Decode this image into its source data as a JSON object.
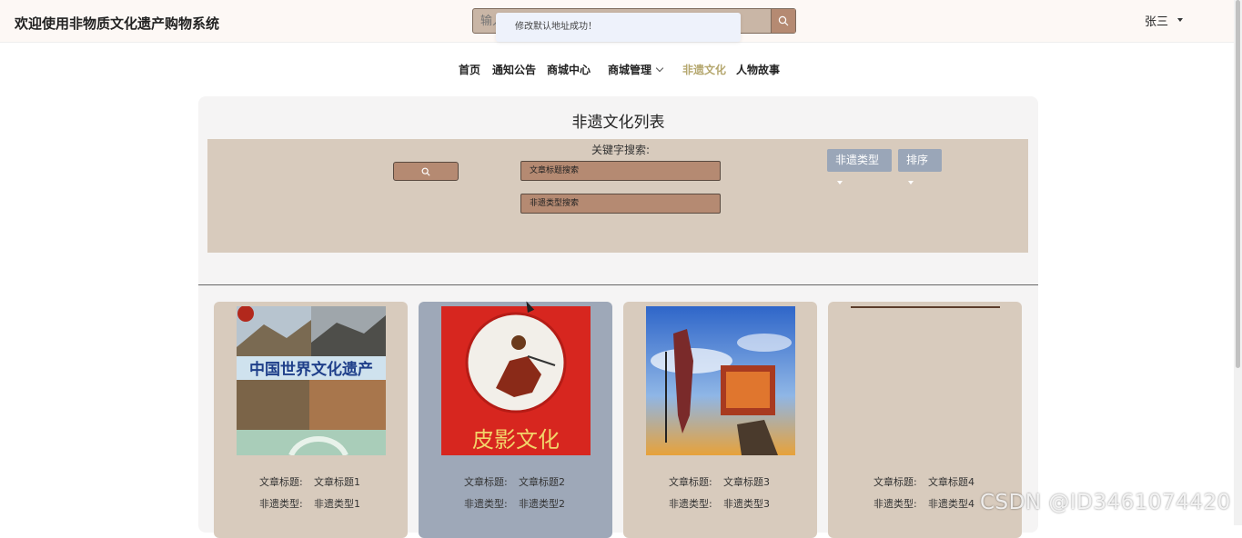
{
  "header": {
    "site_title": "欢迎使用非物质文化遗产购物系统",
    "search_placeholder": "输入",
    "toast": "修改默认地址成功！",
    "user_name": "张三"
  },
  "nav": {
    "items": [
      {
        "label": "首页"
      },
      {
        "label": "通知公告"
      },
      {
        "label": "商城中心"
      },
      {
        "label": "商城管理"
      },
      {
        "label": "非遗文化"
      },
      {
        "label": "人物故事"
      }
    ]
  },
  "main": {
    "title": "非遗文化列表",
    "filter": {
      "keyword_label": "关键字搜索:",
      "title_placeholder": "文章标题搜索",
      "type_placeholder": "非遗类型搜索",
      "type_dropdown": "非遗类型",
      "sort_dropdown": "排序"
    },
    "field_title_label": "文章标题:",
    "field_type_label": "非遗类型:",
    "cards": [
      {
        "title": "文章标题1",
        "type": "非遗类型1",
        "image_text": "中国世界文化遗产",
        "bg": "#d8cbbd"
      },
      {
        "title": "文章标题2",
        "type": "非遗类型2",
        "image_text": "皮影文化",
        "bg": "#9ea8b8"
      },
      {
        "title": "文章标题3",
        "type": "非遗类型3",
        "image_text": "",
        "bg": "#d8cbbd"
      },
      {
        "title": "文章标题4",
        "type": "非遗类型4",
        "image_text": "",
        "bg": "#d8cbbd"
      }
    ]
  },
  "watermark": "CSDN @ID3461074420",
  "colors": {
    "accent_brown": "#b58a72",
    "filter_bg": "#d8cbbd",
    "dropdown_bg": "#9aa6b8",
    "active_nav": "#b5a76e"
  }
}
